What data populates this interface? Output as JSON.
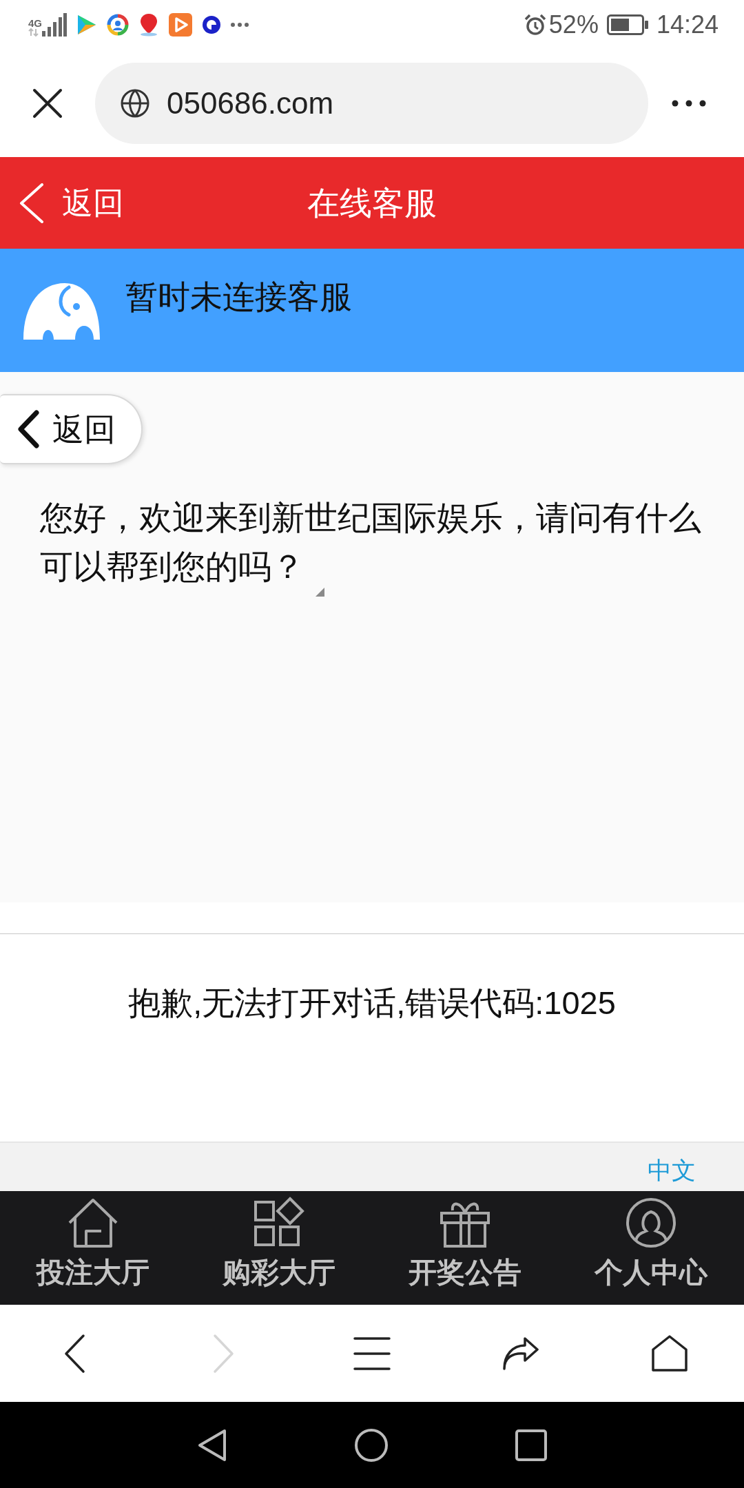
{
  "status_bar": {
    "network": "4G",
    "battery": "52%",
    "time": "14:24"
  },
  "browser": {
    "url": "050686.com"
  },
  "header": {
    "back": "返回",
    "title": "在线客服"
  },
  "agent_banner": {
    "status": "暂时未连接客服"
  },
  "chat": {
    "back_button": "返回",
    "messages": [
      {
        "text": "您好，欢迎来到新世纪国际娱乐，请问有什么可以帮到您的吗？"
      }
    ]
  },
  "error": {
    "message": "抱歉,无法打开对话,错误代码:1025"
  },
  "language_link": "中文",
  "tab_bar": [
    {
      "label": "投注大厅",
      "kind": "home"
    },
    {
      "label": "购彩大厅",
      "kind": "apps"
    },
    {
      "label": "开奖公告",
      "kind": "gift"
    },
    {
      "label": "个人中心",
      "kind": "user"
    }
  ],
  "browser_nav": [
    {
      "kind": "back",
      "disabled": false
    },
    {
      "kind": "forward",
      "disabled": true
    },
    {
      "kind": "menu",
      "disabled": false
    },
    {
      "kind": "share",
      "disabled": false
    },
    {
      "kind": "home",
      "disabled": false
    }
  ]
}
